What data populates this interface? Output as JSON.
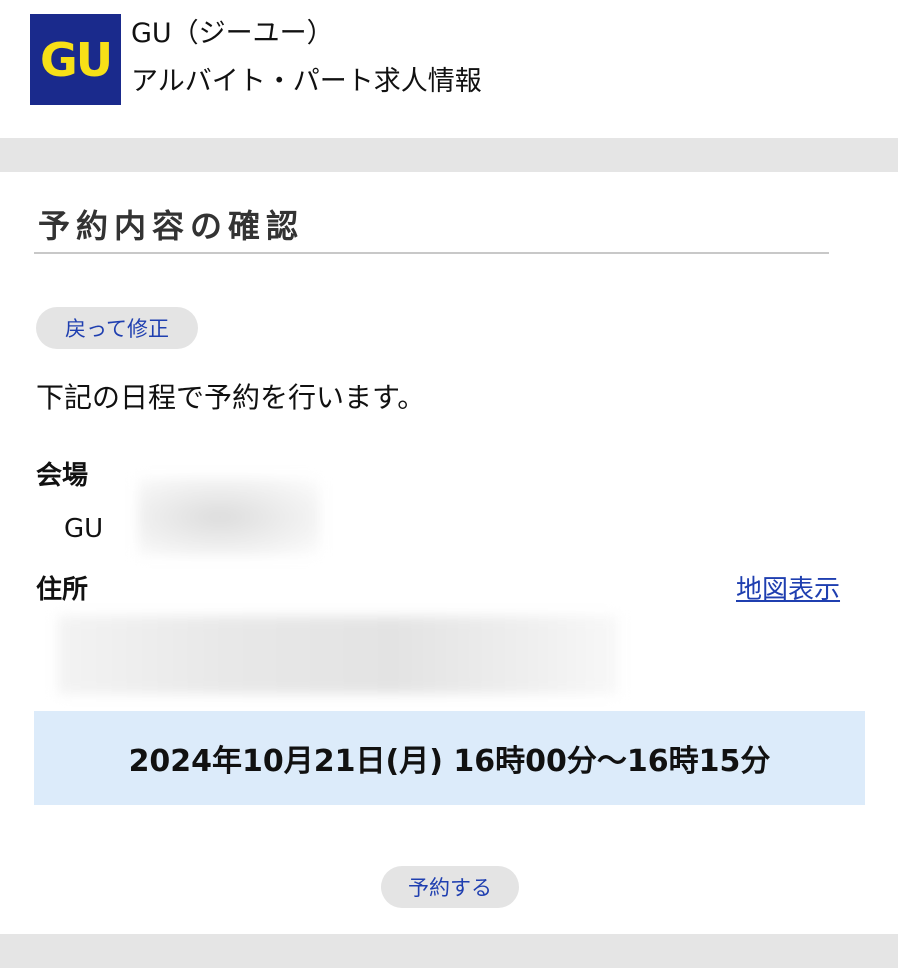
{
  "header": {
    "logo_text": "GU",
    "company_name": "GU（ジーユー）",
    "subtitle": "アルバイト・パート求人情報",
    "logo_bg_color": "#1a2a8c",
    "logo_text_color": "#f7e017"
  },
  "main": {
    "title": "予約内容の確認",
    "back_button_label": "戻って修正",
    "intro": "下記の日程で予約を行います。",
    "venue": {
      "label": "会場",
      "value": "GU"
    },
    "address": {
      "label": "住所",
      "map_link_label": "地図表示"
    },
    "schedule": "2024年10月21日(月) 16時00分〜16時15分",
    "reserve_button_label": "予約する"
  },
  "colors": {
    "link": "#1f3fb0",
    "schedule_bg": "#dcebfa",
    "band_gray": "#e5e5e5"
  }
}
